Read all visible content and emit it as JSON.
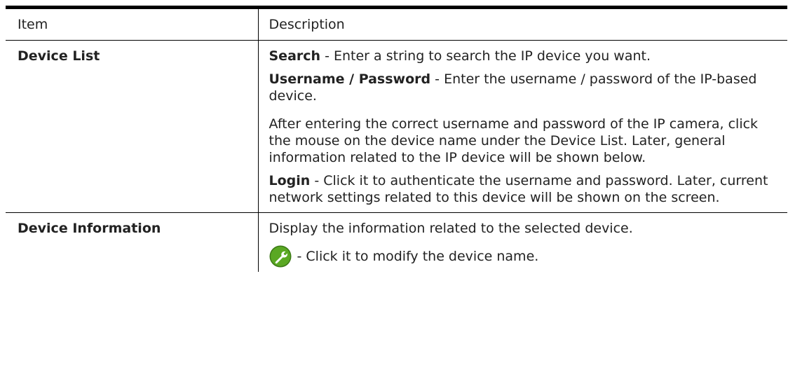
{
  "table": {
    "headers": {
      "item": "Item",
      "description": "Description"
    },
    "rows": [
      {
        "item": "Device List",
        "entries": [
          {
            "keyword": "Search",
            "text": " - Enter a string to search the IP device you want."
          },
          {
            "keyword": "Username / Password",
            "text": " - Enter the username / password of the IP-based device."
          },
          {
            "keyword": "",
            "text": "After entering the correct username and password of the IP camera, click the mouse on the device name under the Device List. Later, general information related to the IP device will be shown below."
          },
          {
            "keyword": "Login",
            "text": " - Click it to authenticate the username and password. Later, current network settings related to this device will be shown on the screen."
          }
        ]
      },
      {
        "item": "Device Information",
        "entries": [
          {
            "text": "Display the information related to the selected device."
          },
          {
            "icon": "wrench-icon",
            "text": " - Click it to modify the device name."
          }
        ]
      }
    ]
  },
  "colors": {
    "icon_green": "#5aa823",
    "icon_dark_green": "#3c7a16",
    "text": "#222222",
    "rule": "#000000"
  }
}
